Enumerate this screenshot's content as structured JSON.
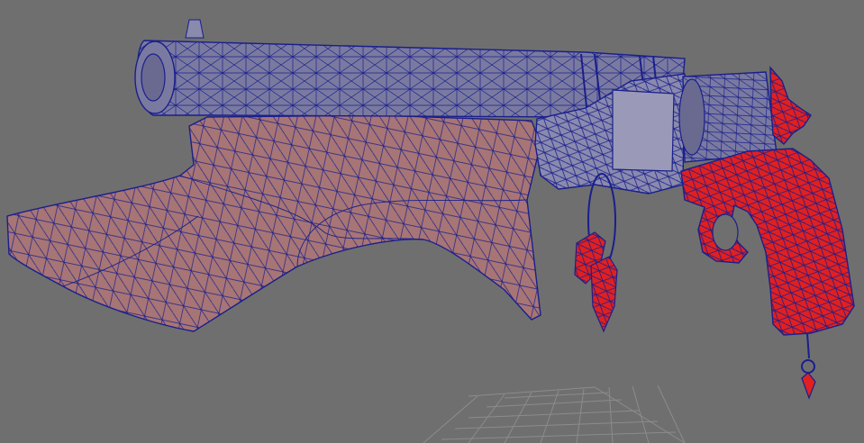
{
  "viewport": {
    "background_color": "#6f6f6f",
    "wireframe_color": "#1a1f8c",
    "grid_color": "#8c8c8c",
    "objects": [
      {
        "name": "barrel",
        "color": "#7a7aa0"
      },
      {
        "name": "stock",
        "color": "#a77575"
      },
      {
        "name": "frame-mechanism",
        "color": "#8a8aae"
      },
      {
        "name": "cylinder",
        "color": "#7a7aa0"
      },
      {
        "name": "grip",
        "color": "#e02020"
      },
      {
        "name": "hammer",
        "color": "#e02020"
      },
      {
        "name": "pendant-crystals",
        "color": "#e02020"
      }
    ]
  }
}
